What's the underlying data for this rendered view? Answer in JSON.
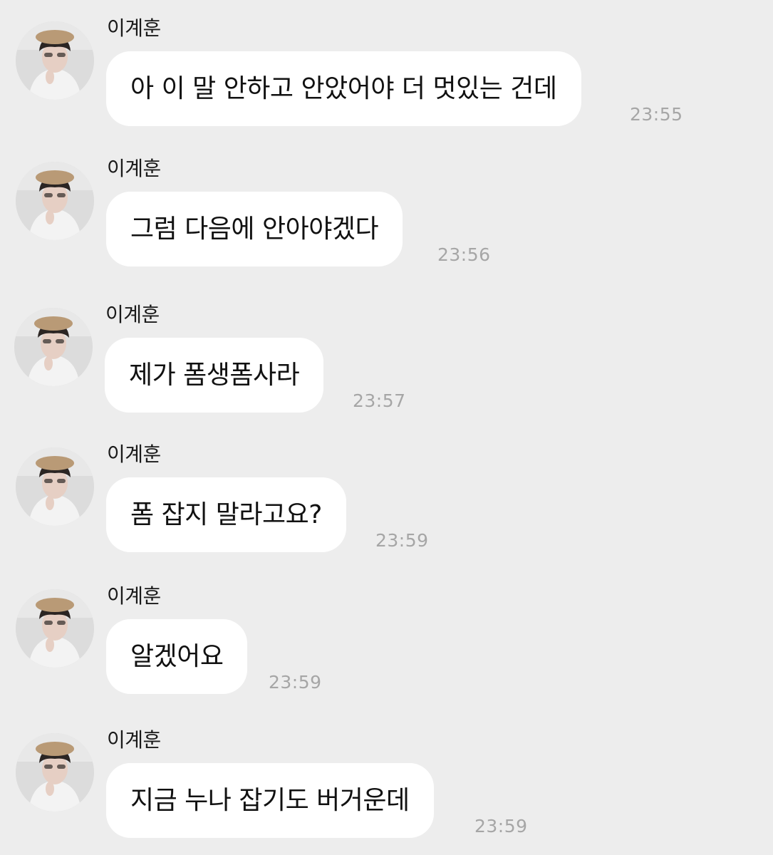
{
  "messages": [
    {
      "sender": "이계훈",
      "text": "아 이 말 안하고 안았어야 더 멋있는 건데",
      "time": "23:55"
    },
    {
      "sender": "이계훈",
      "text": "그럼 다음에 안아야겠다",
      "time": "23:56"
    },
    {
      "sender": "이계훈",
      "text": "제가 폼생폼사라",
      "time": "23:57"
    },
    {
      "sender": "이계훈",
      "text": "폼 잡지 말라고요?",
      "time": "23:59"
    },
    {
      "sender": "이계훈",
      "text": "알겠어요",
      "time": "23:59"
    },
    {
      "sender": "이계훈",
      "text": "지금 누나 잡기도 버거운데",
      "time": "23:59"
    }
  ],
  "colors": {
    "background": "#ededed",
    "bubble": "#ffffff",
    "timestamp": "#a6a6a6",
    "text": "#111111"
  },
  "icons": {
    "avatar": "profile-photo-avatar"
  }
}
